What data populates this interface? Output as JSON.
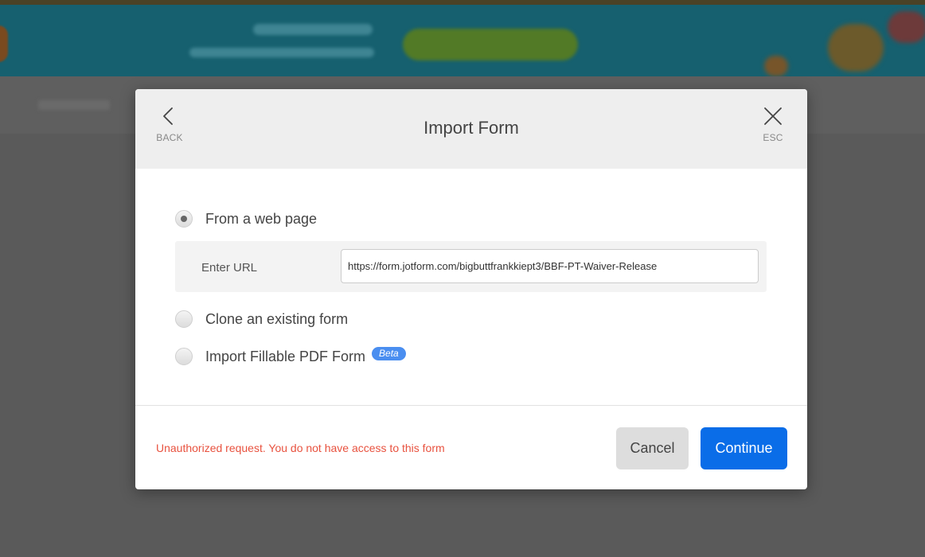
{
  "modal": {
    "title": "Import Form",
    "back_label": "BACK",
    "esc_label": "ESC",
    "options": [
      {
        "label": "From a web page",
        "checked": true
      },
      {
        "label": "Clone an existing form",
        "checked": false
      },
      {
        "label": "Import Fillable PDF Form",
        "checked": false,
        "badge": "Beta"
      }
    ],
    "url": {
      "label": "Enter URL",
      "value": "https://form.jotform.com/bigbuttfrankkiept3/BBF-PT-Waiver-Release"
    },
    "error": "Unauthorized request. You do not have access to this form",
    "cancel_label": "Cancel",
    "continue_label": "Continue"
  },
  "colors": {
    "accent": "#0a6de8",
    "error": "#e8523f",
    "beta_badge": "#4a8ef0",
    "overlay": "#5a5a5a"
  },
  "icons": {
    "back": "chevron-left-icon",
    "esc": "close-icon"
  }
}
